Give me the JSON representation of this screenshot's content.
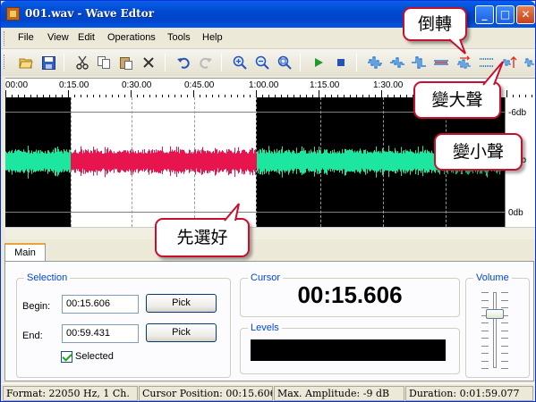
{
  "window": {
    "title": "001.wav - Wave Edtor"
  },
  "menu": [
    "File",
    "View",
    "Edit",
    "Operations",
    "Tools",
    "Help"
  ],
  "toolbar": {
    "icons": [
      "open-icon",
      "save-icon",
      "cut-icon",
      "copy-icon",
      "paste-icon",
      "delete-icon",
      "undo-icon",
      "redo-icon",
      "zoom-in-icon",
      "zoom-out-icon",
      "zoom-fit-icon",
      "play-icon",
      "stop-icon",
      "wave-effect-1-icon",
      "wave-effect-2-icon",
      "wave-effect-3-icon",
      "wave-effect-4-icon",
      "reverse-icon",
      "normalize-icon",
      "amplify-icon",
      "attenuate-icon"
    ]
  },
  "ruler": {
    "labels": [
      "00:00",
      "0:15.00",
      "0:30.00",
      "0:45.00",
      "1:00.00",
      "1:15.00",
      "1:30.00"
    ]
  },
  "scale": {
    "db_top": "-6db",
    "db_mid": "-6db",
    "db_bottom": "0db"
  },
  "colors": {
    "unselected_wave": "#1DE6A0",
    "selected_wave": "#E8144E",
    "callout_border": "#C8102E",
    "titlebar": "#0054E3"
  },
  "tabs": [
    "Main"
  ],
  "selection": {
    "legend": "Selection",
    "begin_label": "Begin:",
    "begin_value": "00:15.606",
    "end_label": "End:",
    "end_value": "00:59.431",
    "pick_label": "Pick",
    "selected_label": "Selected",
    "selected_checked": true
  },
  "cursor": {
    "legend": "Cursor",
    "value": "00:15.606"
  },
  "levels": {
    "legend": "Levels"
  },
  "volume": {
    "legend": "Volume",
    "level": 0.72
  },
  "status": {
    "format": "Format: 22050 Hz, 1 Ch.",
    "cursor_position": "Cursor Position: 00:15.606",
    "max_amplitude": "Max. Amplitude: -9 dB",
    "duration": "Duration: 0:01:59.077"
  },
  "callouts": {
    "reverse": "倒轉",
    "louder": "變大聲",
    "quieter": "變小聲",
    "preselect": "先選好"
  }
}
